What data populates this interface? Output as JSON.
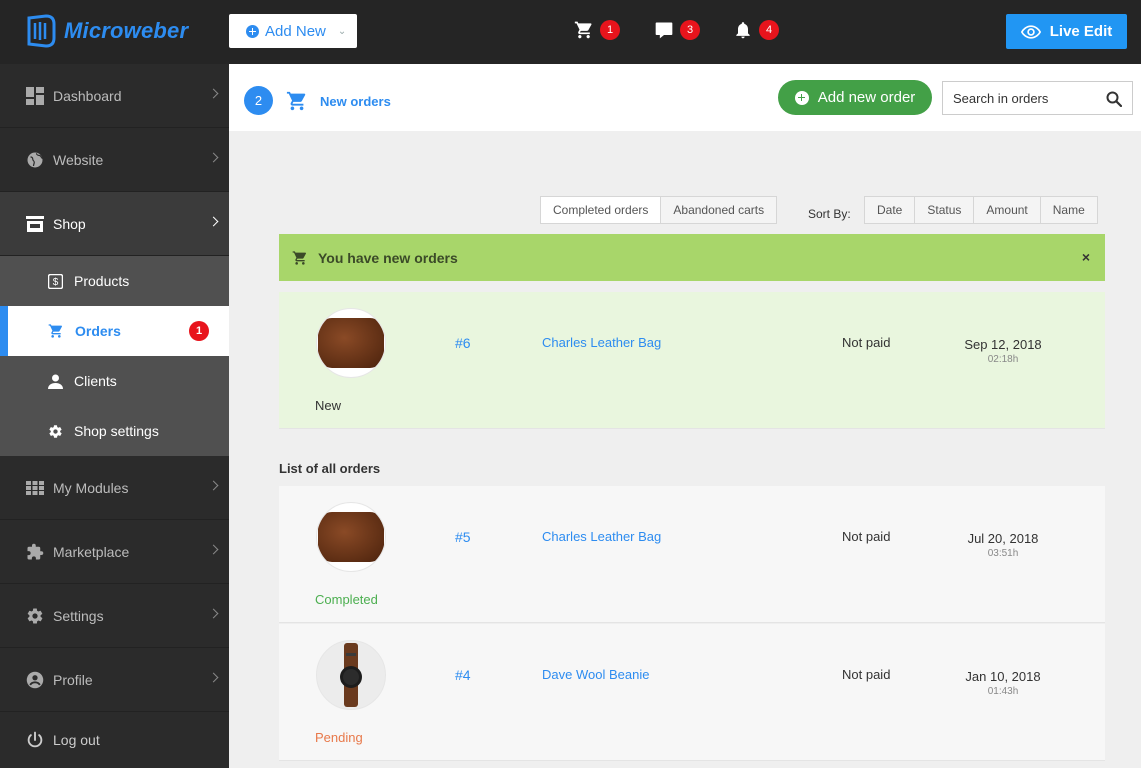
{
  "topbar": {
    "brand": "Microweber",
    "add_new_label": "Add New",
    "cart_count": "1",
    "comments_count": "3",
    "notifications_count": "4",
    "live_edit_label": "Live Edit"
  },
  "sidebar": {
    "items": [
      {
        "label": "Dashboard"
      },
      {
        "label": "Website"
      },
      {
        "label": "Shop"
      },
      {
        "label": "My Modules"
      },
      {
        "label": "Marketplace"
      },
      {
        "label": "Settings"
      },
      {
        "label": "Profile"
      }
    ],
    "shop_submenu": [
      {
        "label": "Products"
      },
      {
        "label": "Orders",
        "badge": "1"
      },
      {
        "label": "Clients"
      },
      {
        "label": "Shop settings"
      }
    ],
    "logout_label": "Log out"
  },
  "header": {
    "step": "2",
    "title": "New orders",
    "add_order_label": "Add new order",
    "search_placeholder": "Search in orders"
  },
  "filters": {
    "tabs": [
      "Completed orders",
      "Abandoned carts"
    ],
    "sort_label": "Sort By:",
    "sort_options": [
      "Date",
      "Status",
      "Amount",
      "Name"
    ]
  },
  "alert": {
    "message": "You have new orders",
    "close": "×"
  },
  "new_orders": [
    {
      "number": "#6",
      "product": "Charles Leather Bag",
      "payment": "Not paid",
      "date": "Sep 12, 2018",
      "time": "02:18h",
      "status": "New"
    }
  ],
  "list_title": "List of all orders",
  "orders": [
    {
      "number": "#5",
      "product": "Charles Leather Bag",
      "payment": "Not paid",
      "date": "Jul 20, 2018",
      "time": "03:51h",
      "status": "Completed"
    },
    {
      "number": "#4",
      "product": "Dave Wool Beanie",
      "payment": "Not paid",
      "date": "Jan 10, 2018",
      "time": "01:43h",
      "status": "Pending"
    }
  ],
  "colors": {
    "accent": "#2d8cf0",
    "success": "#43a047",
    "alert_bg": "#a8d66a",
    "status_completed": "#4caf50",
    "status_pending": "#e8794a"
  }
}
